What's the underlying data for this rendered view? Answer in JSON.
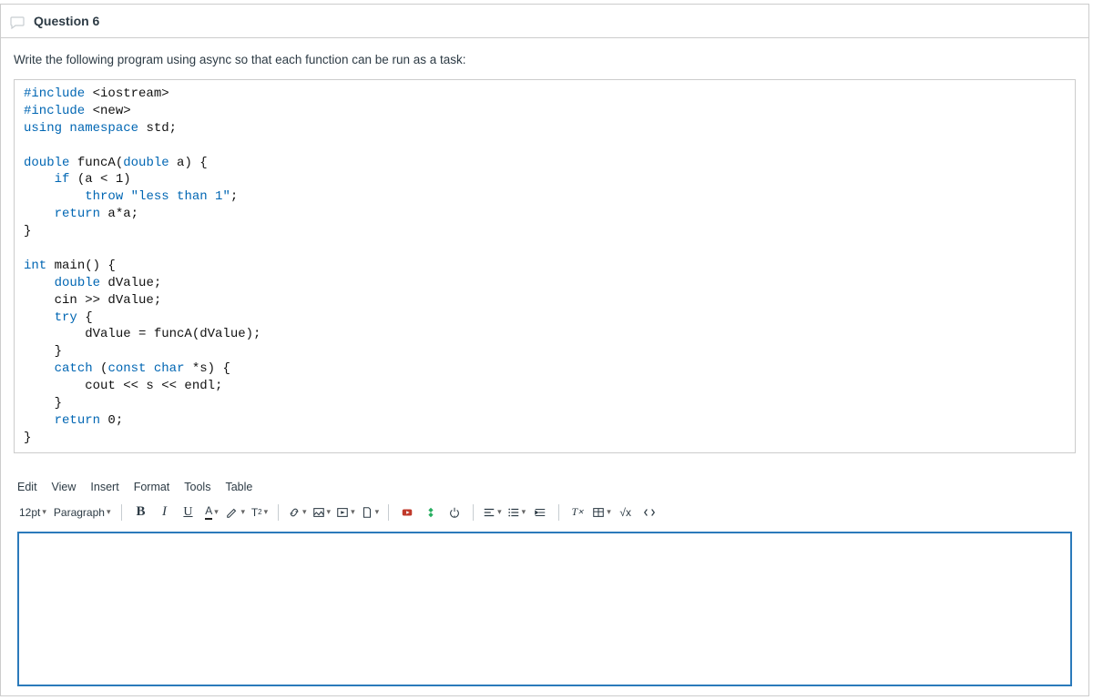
{
  "question": {
    "title": "Question 6",
    "prompt": "Write the following program using async so that each function can be run as a task:"
  },
  "code": {
    "l1a": "#include",
    "l1b": " <iostream>",
    "l2a": "#include",
    "l2b": " <new>",
    "l3a": "using",
    "l3b": " ",
    "l3c": "namespace",
    "l3d": " std;",
    "l4": " ",
    "l5a": "double",
    "l5b": " funcA(",
    "l5c": "double",
    "l5d": " a) {",
    "l6a": "    ",
    "l6b": "if",
    "l6c": " (a < 1)",
    "l7a": "        ",
    "l7b": "throw",
    "l7c": " ",
    "l7d": "\"less than 1\"",
    "l7e": ";",
    "l8a": "    ",
    "l8b": "return",
    "l8c": " a*a;",
    "l9": "}",
    "l10": " ",
    "l11a": "int",
    "l11b": " main() {",
    "l12a": "    ",
    "l12b": "double",
    "l12c": " dValue;",
    "l13": "    cin >> dValue;",
    "l14a": "    ",
    "l14b": "try",
    "l14c": " {",
    "l15": "        dValue = funcA(dValue);",
    "l16": "    }",
    "l17a": "    ",
    "l17b": "catch",
    "l17c": " (",
    "l17d": "const",
    "l17e": " ",
    "l17f": "char",
    "l17g": " *s) {",
    "l18": "        cout << s << endl;",
    "l19": "    }",
    "l20a": "    ",
    "l20b": "return",
    "l20c": " 0;",
    "l21": "}"
  },
  "menus": [
    "Edit",
    "View",
    "Insert",
    "Format",
    "Tools",
    "Table"
  ],
  "toolbar": {
    "fontsize": "12pt",
    "paragraph": "Paragraph"
  }
}
